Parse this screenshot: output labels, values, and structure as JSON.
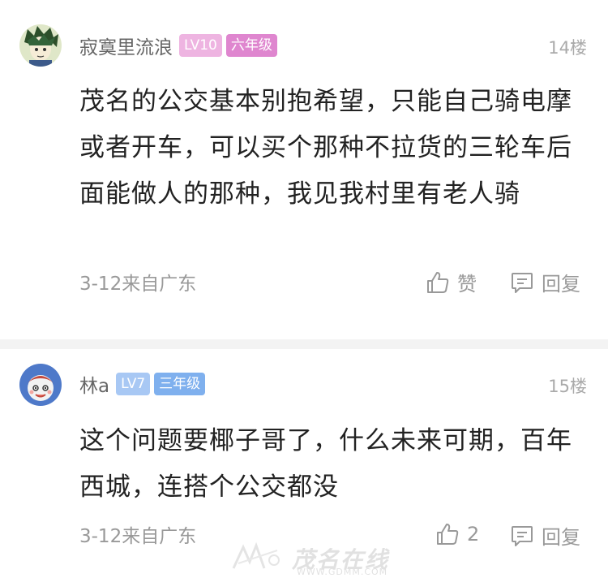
{
  "comments": [
    {
      "username": "寂寞里流浪",
      "level": "LV10",
      "grade": "六年级",
      "floor": "14楼",
      "text": "茂名的公交基本别抱希望，只能自己骑电摩或者开车，可以买个那种不拉货的三轮车后面能做人的那种，我见我村里有老人骑",
      "meta": "3-12来自广东",
      "like_label": "赞",
      "reply_label": "回复",
      "avatar_icon": "anime-boy-avatar-icon",
      "badge_colors": {
        "level": "#eeb4e1",
        "grade": "#df86cf"
      }
    },
    {
      "username": "林a",
      "level": "LV7",
      "grade": "三年级",
      "floor": "15楼",
      "text": "这个问题要椰子哥了，什么未来可期，百年西城，连搭个公交都没",
      "meta": "3-12来自广东",
      "like_label": "2",
      "reply_label": "回复",
      "avatar_icon": "cartoon-girl-avatar-icon",
      "badge_colors": {
        "level": "#a8c8f4",
        "grade": "#7fb0ee"
      }
    }
  ],
  "watermark": {
    "text": "茂名在线",
    "url": "WWW.GDMM.COM"
  }
}
